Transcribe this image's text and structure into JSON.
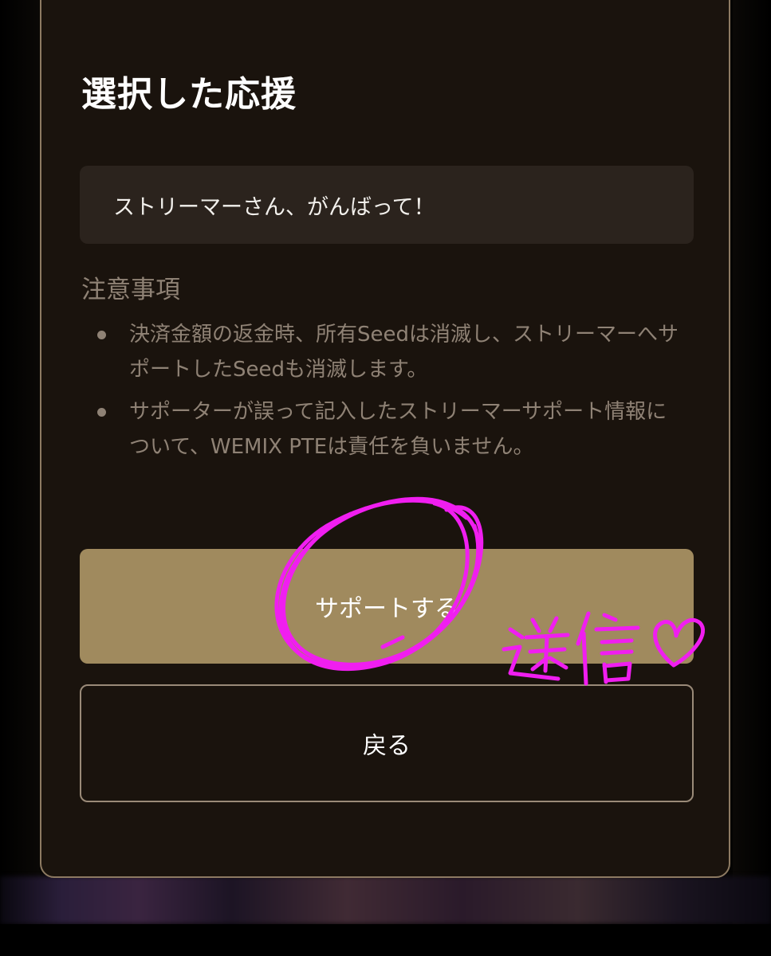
{
  "modal": {
    "title": "選択した応援",
    "message": "ストリーマーさん、がんばって！"
  },
  "notes": {
    "title": "注意事項",
    "items": [
      "決済金額の返金時、所有Seedは消滅し、ストリーマーへサポートしたSeedも消滅します。",
      "サポーターが誤って記入したストリーマーサポート情報について、WEMIX PTEは責任を負いません。"
    ]
  },
  "buttons": {
    "support_label": "サポートする",
    "back_label": "戻る"
  },
  "annotation": {
    "handwritten_text": "送信♡",
    "color": "#f01ef0"
  },
  "colors": {
    "modal_background": "#1a130d",
    "modal_border": "#8d7a62",
    "message_box": "#2b231d",
    "primary_button": "#a08a5e",
    "muted_text": "#8f8275"
  }
}
